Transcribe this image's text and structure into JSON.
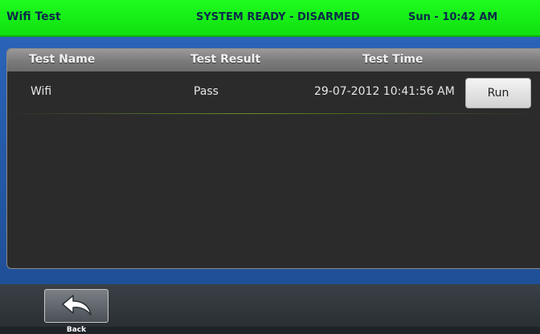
{
  "status_bar": {
    "title": "Wifi Test",
    "system_state": "SYSTEM READY - DISARMED",
    "clock": "Sun - 10:42 AM"
  },
  "table": {
    "headers": [
      "Test Name",
      "Test Result",
      "Test Time"
    ],
    "rows": [
      {
        "name": "Wifi",
        "result": "Pass",
        "time": "29-07-2012 10:41:56 AM",
        "action_label": "Run"
      }
    ]
  },
  "footer": {
    "back_label": "Back",
    "back_icon": "back-arrow-icon"
  },
  "colors": {
    "status_bar": "#1efc1e",
    "band": "#2a63b8",
    "panel": "#2b2b2b"
  }
}
